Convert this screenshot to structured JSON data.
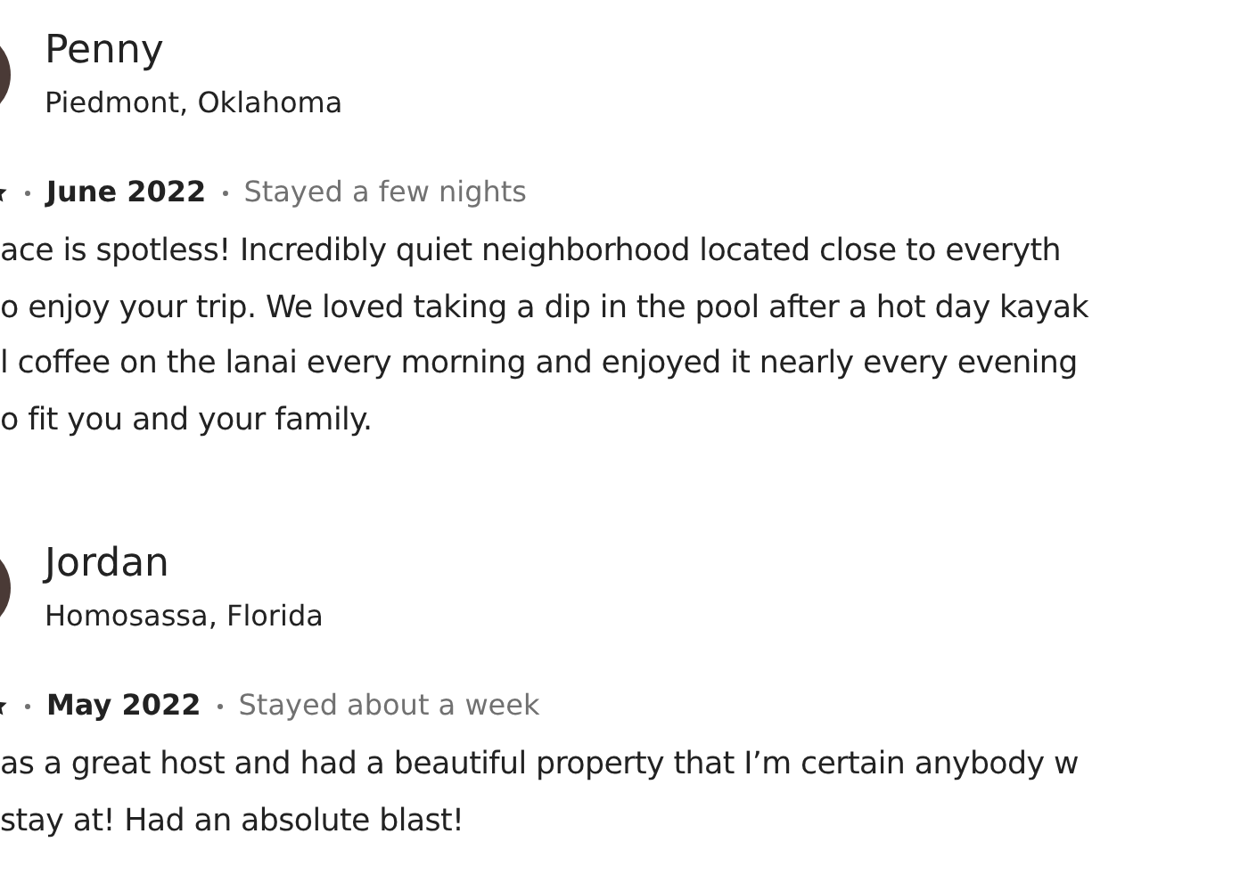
{
  "reviews": [
    {
      "name": "Penny",
      "location": "Piedmont, Oklahoma",
      "date": "June 2022",
      "stay": "Stayed a few nights",
      "lines": [
        "ace is spotless! Incredibly quiet neighborhood located close to everyth",
        "o enjoy your trip. We loved taking a dip in the pool after a hot day kayak",
        "l coffee on the lanai every morning and enjoyed it nearly every evening",
        "o fit you and your family."
      ]
    },
    {
      "name": "Jordan",
      "location": "Homosassa, Florida",
      "date": "May 2022",
      "stay": "Stayed about a week",
      "lines": [
        "as a great host and had a beautiful property that I’m certain anybody w",
        "stay at! Had an absolute blast!"
      ]
    }
  ]
}
